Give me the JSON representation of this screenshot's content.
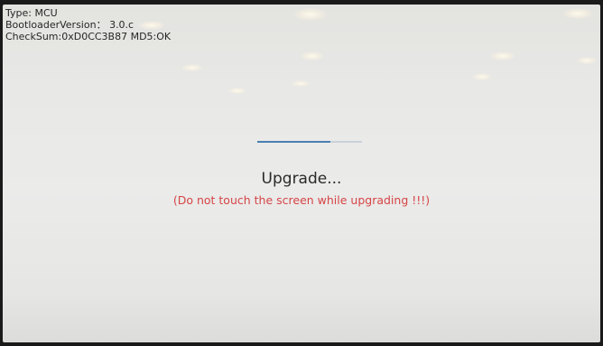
{
  "device_info": {
    "type_line": "Type: MCU",
    "bootloader_line": "BootloaderVersion： 3.0.c",
    "checksum_line": "CheckSum:0xD0CC3B87 MD5:OK"
  },
  "upgrade": {
    "progress_fraction": 0.7,
    "title": "Upgrade...",
    "warning": "(Do not touch the screen while upgrading !!!)"
  },
  "colors": {
    "warning_text": "#d64545",
    "progress_fill": "#4a7fb3",
    "progress_track": "#c9d2da",
    "screen_background": "#e8e8e6"
  }
}
